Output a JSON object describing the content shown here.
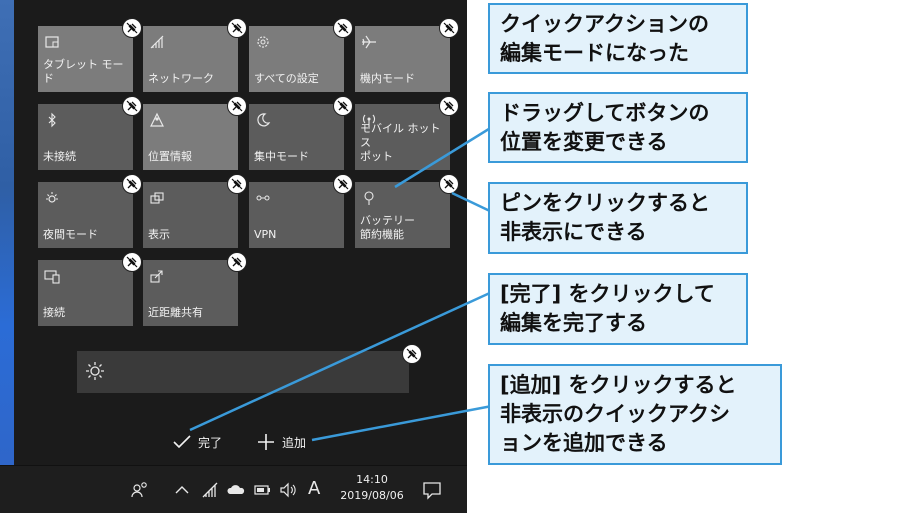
{
  "tiles": [
    {
      "label": "タブレット モード",
      "icon": "tablet-mode-icon"
    },
    {
      "label": "ネットワーク",
      "icon": "network-icon"
    },
    {
      "label": "すべての設定",
      "icon": "settings-gear-icon"
    },
    {
      "label": "機内モード",
      "icon": "airplane-icon"
    },
    {
      "label": "未接続",
      "icon": "bluetooth-icon"
    },
    {
      "label": "位置情報",
      "icon": "location-icon"
    },
    {
      "label": "集中モード",
      "icon": "moon-icon"
    },
    {
      "label": "モバイル ホットス\nポット",
      "icon": "hotspot-icon"
    },
    {
      "label": "夜間モード",
      "icon": "night-light-icon"
    },
    {
      "label": "表示",
      "icon": "project-icon"
    },
    {
      "label": "VPN",
      "icon": "vpn-icon"
    },
    {
      "label": "バッテリー\n節約機能",
      "icon": "battery-saver-icon"
    },
    {
      "label": "接続",
      "icon": "connect-icon"
    },
    {
      "label": "近距離共有",
      "icon": "nearby-share-icon"
    }
  ],
  "footer": {
    "done_label": "完了",
    "add_label": "追加"
  },
  "taskbar": {
    "time": "14:10",
    "date": "2019/08/06",
    "ime": "A"
  },
  "callouts": {
    "edit_mode": "クイックアクションの\n編集モードになった",
    "drag": "ドラッグしてボタンの\n位置を変更できる",
    "pin": "ピンをクリックすると\n非表示にできる",
    "done": "[完了] をクリックして\n編集を完了する",
    "add": "[追加] をクリックすると\n非表示のクイックアクシ\nョンを追加できる"
  },
  "colors": {
    "callout_bg": "#e3f2fb",
    "callout_border": "#3a9ad9",
    "accent_blue": "#2f66c9"
  }
}
